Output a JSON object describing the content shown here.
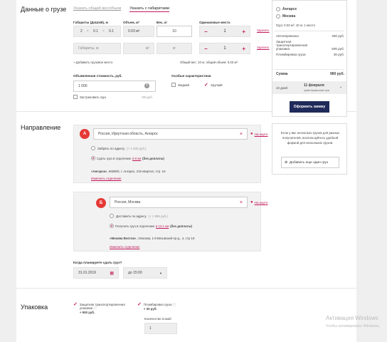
{
  "cargo": {
    "title": "Данные о грузе",
    "tab_total": "Указать общий вес/объем",
    "tab_dims": "Указать с габаритами",
    "lbl_dims": "Габариты (ДхШхВ), м",
    "lbl_volume": "Объем, м³",
    "lbl_weight": "Вес, кг",
    "lbl_same": "Одинаковые места",
    "row1_dims": [
      "2",
      "0.1",
      "0.1"
    ],
    "row1_volume": "0.03 м³",
    "row1_weight": "10",
    "row1_count": "1",
    "row2_dims_placeholder": "Габариты, м",
    "row2_volume_placeholder": "м³",
    "row2_weight_placeholder": "кг",
    "row2_count": "1",
    "delete": "Удалить",
    "add_place": "+ Добавить грузовое место",
    "summary": "Общий вес: 10 кг, общий объем: 0.03 м³",
    "lbl_declared": "Объявленная стоимость, руб.",
    "declared_value": "1 000",
    "insure": "Застраховать груз",
    "insure_price": "+50 руб.",
    "lbl_special": "Особые характеристики",
    "liquid": "Жидкий",
    "fragile": "Хрупкий"
  },
  "direction": {
    "title": "Направление",
    "a_badge": "А",
    "a_city": "Россия, Иркутская область, Ангарск",
    "map": "На карте",
    "a_pickup": "Забрать по адресу",
    "a_pickup_price": "(+ 1 533 руб.)",
    "a_dropoff_prefix": "Сдать груз в отделении",
    "a_dropoff_dist": "в 8 км",
    "a_dropoff_extra": "(без доплаты)",
    "a_office_name": "«Ангарск»",
    "a_office_addr": ", 665800, г. Ангарск, 215 квартал, стр. 16",
    "change_office": "Изменить отделение",
    "b_badge": "Б",
    "b_city": "Россия, Москва",
    "b_delivery": "Доставить по адресу",
    "b_delivery_price": "(+ 1 996 руб.)",
    "b_receive_prefix": "Получить груз в отделении",
    "b_receive_dist": "в 13.1 км",
    "b_receive_extra": "(без доплаты)",
    "b_office_name": "«Москва Восток»",
    "b_office_addr": ", г.Москва, 1-й Вязовский пр-д., 4, стр 19",
    "lbl_when": "Когда планируете сдать груз?",
    "date": "31.01.2019",
    "time": "до 15:00"
  },
  "packing": {
    "title": "Упаковка",
    "protective": "Защитная транспортировочная упаковка",
    "protective_price": "+ 500 руб.",
    "seal": "Пломбировка груза",
    "seal_price": "+ 30 руб.",
    "lbl_seals": "Количество пломб",
    "seals_count": "1"
  },
  "summary_card": {
    "from": "Ангарск",
    "to": "Москва",
    "cargo_info": "Груз: 0.03 м³, 10 кг, 1 место",
    "items": [
      {
        "name": "Автоперевозка",
        "price": "450 руб."
      },
      {
        "name": "Защитная транспортировочная упаковка",
        "price": "500 руб."
      },
      {
        "name": "Пломбировка груза",
        "price": "30 руб."
      }
    ],
    "total_label": "Сумма",
    "total_value": "980 руб.",
    "days": "10 дней",
    "eta_date": "11 февраля",
    "eta_note": "ориентировочный срок",
    "order_button": "Оформить заявку"
  },
  "multi_card": {
    "text": "Если у вас несколько грузов для разных получателей, воспользуйтесь удобной формой для нескольких грузов.",
    "add_button": "Добавить еще один груз"
  },
  "watermark": {
    "title": "Активация Windows",
    "subtitle": "Чтобы активировать Windows,"
  },
  "colors": {
    "accent": "#c2185b",
    "badge": "#e53935",
    "button": "#1f2a5a"
  }
}
